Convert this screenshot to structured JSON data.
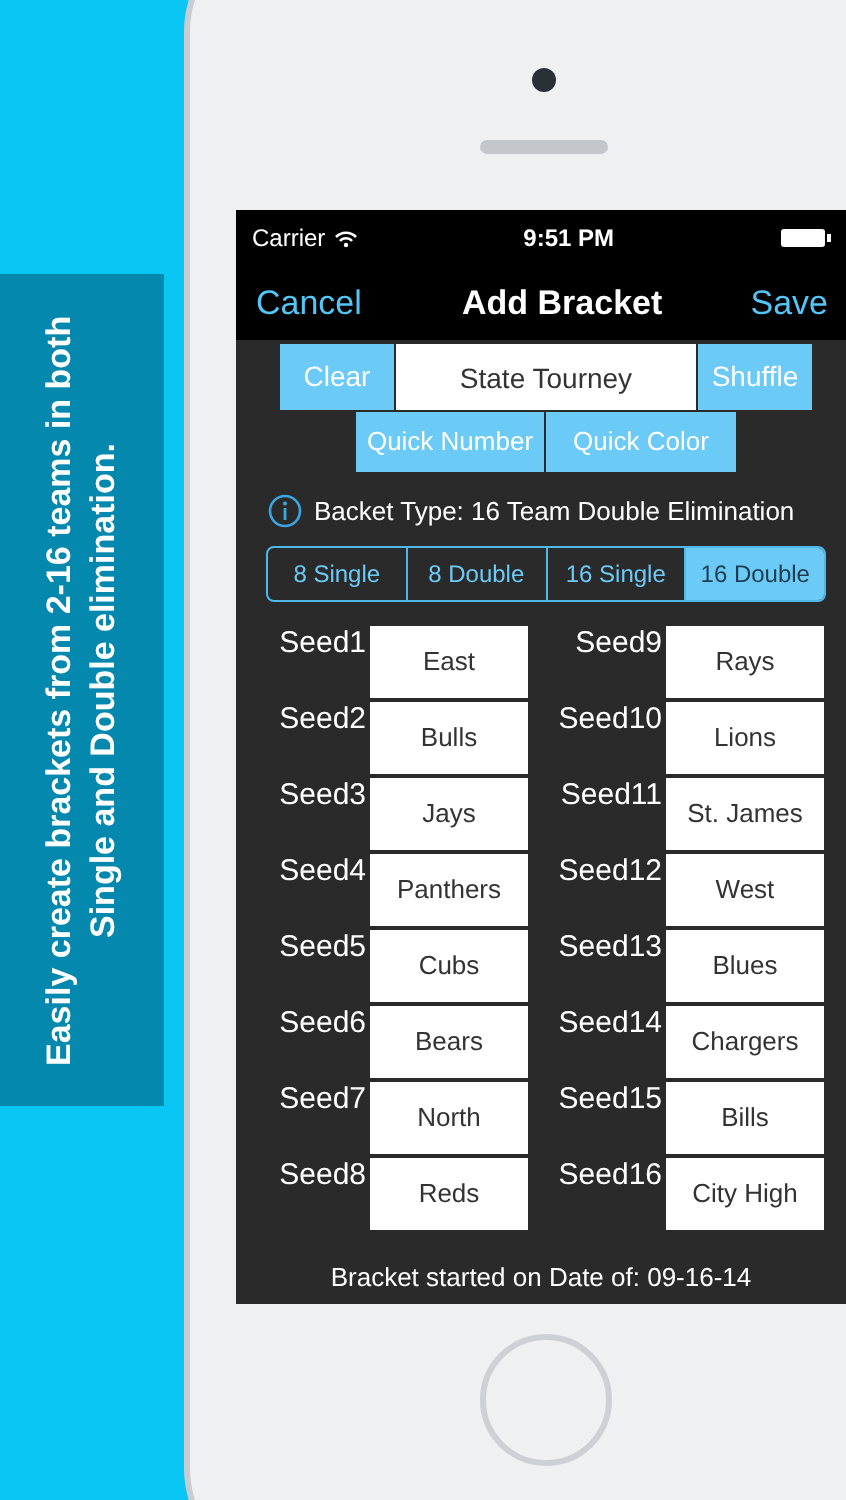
{
  "banner": {
    "text": "Easily create brackets from 2-16 teams in both Single and Double elimination."
  },
  "status_bar": {
    "carrier": "Carrier",
    "time": "9:51 PM"
  },
  "nav": {
    "left": "Cancel",
    "title": "Add Bracket",
    "right": "Save"
  },
  "toolbar": {
    "clear": "Clear",
    "name_value": "State Tourney",
    "shuffle": "Shuffle",
    "quick_number": "Quick Number",
    "quick_color": "Quick Color"
  },
  "info": "Backet Type: 16 Team Double Elimination",
  "segments": [
    {
      "label": "8 Single",
      "selected": false
    },
    {
      "label": "8 Double",
      "selected": false
    },
    {
      "label": "16 Single",
      "selected": false
    },
    {
      "label": "16 Double",
      "selected": true
    }
  ],
  "seeds_left": [
    {
      "label": "Seed1",
      "value": "East"
    },
    {
      "label": "Seed2",
      "value": "Bulls"
    },
    {
      "label": "Seed3",
      "value": "Jays"
    },
    {
      "label": "Seed4",
      "value": "Panthers"
    },
    {
      "label": "Seed5",
      "value": "Cubs"
    },
    {
      "label": "Seed6",
      "value": "Bears"
    },
    {
      "label": "Seed7",
      "value": "North"
    },
    {
      "label": "Seed8",
      "value": "Reds"
    }
  ],
  "seeds_right": [
    {
      "label": "Seed9",
      "value": "Rays"
    },
    {
      "label": "Seed10",
      "value": "Lions"
    },
    {
      "label": "Seed11",
      "value": "St. James"
    },
    {
      "label": "Seed12",
      "value": "West"
    },
    {
      "label": "Seed13",
      "value": "Blues"
    },
    {
      "label": "Seed14",
      "value": "Chargers"
    },
    {
      "label": "Seed15",
      "value": "Bills"
    },
    {
      "label": "Seed16",
      "value": "City High"
    }
  ],
  "footer": "Bracket started on Date of: 09-16-14"
}
